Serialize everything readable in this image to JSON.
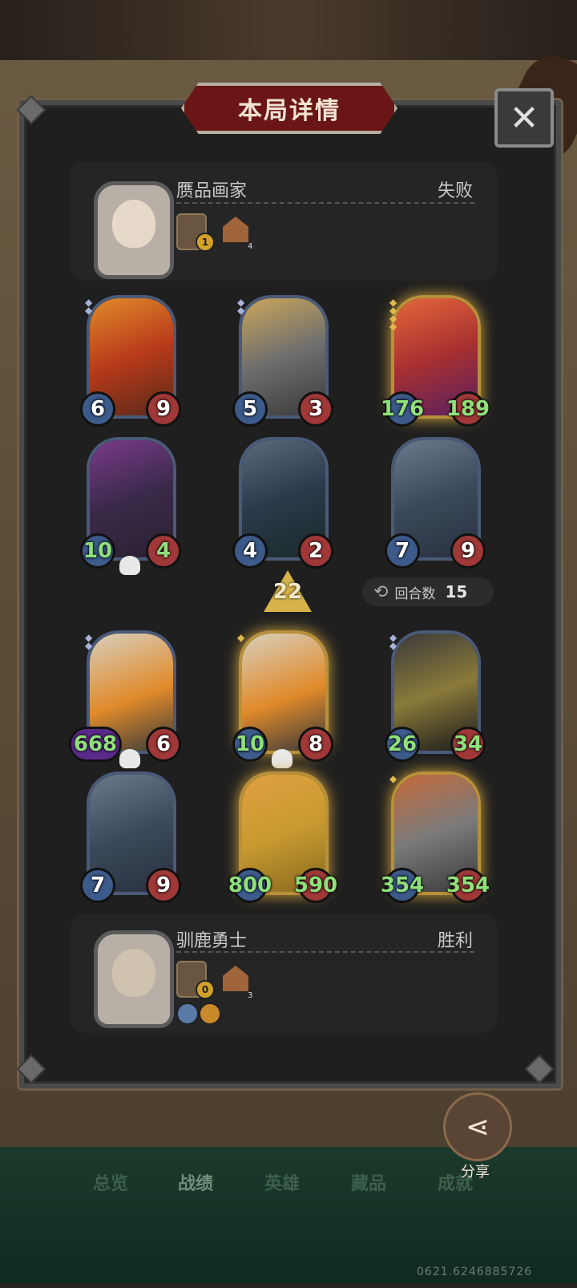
{
  "title": "本局详情",
  "close_label": "✕",
  "opponent": {
    "name": "赝品画家",
    "result": "失败",
    "level": "1",
    "house_count": "4"
  },
  "player": {
    "name": "驯鹿勇士",
    "result": "胜利",
    "level": "0",
    "house_count": "3"
  },
  "opponent_cards": [
    {
      "attack": "6",
      "health": "9"
    },
    {
      "attack": "5",
      "health": "3"
    },
    {
      "attack": "176",
      "health": "189"
    },
    {
      "attack": "10",
      "health": "4"
    },
    {
      "attack": "4",
      "health": "2"
    },
    {
      "attack": "7",
      "health": "9"
    }
  ],
  "player_cards": [
    {
      "attack": "668",
      "health": "6"
    },
    {
      "attack": "10",
      "health": "8"
    },
    {
      "attack": "26",
      "health": "34"
    },
    {
      "attack": "7",
      "health": "9"
    },
    {
      "attack": "800",
      "health": "590"
    },
    {
      "attack": "354",
      "health": "354"
    }
  ],
  "arrow_value": "22",
  "rounds": {
    "label": "回合数",
    "value": "15"
  },
  "tabs": [
    "总览",
    "战绩",
    "英雄",
    "藏品",
    "成就"
  ],
  "share_label": "分享",
  "footer_code": "0621.6246885726",
  "colors": {
    "title_red": "#6a1616",
    "gold": "#d4a640",
    "green_stat": "#8fe07a"
  }
}
